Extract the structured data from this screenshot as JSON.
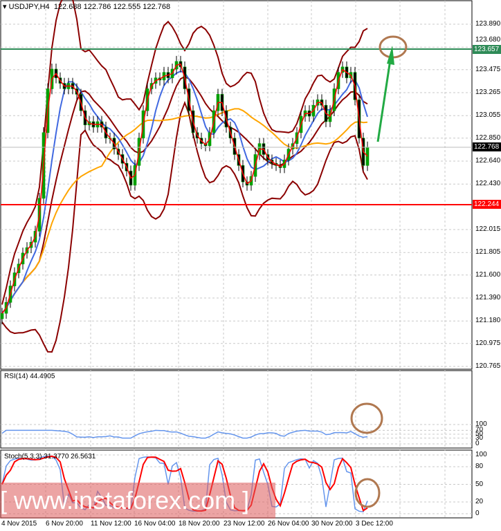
{
  "header": {
    "symbol": "USDJPY,H4",
    "open": "122.688",
    "high": "122.786",
    "low": "122.555",
    "close": "122.768"
  },
  "price_axis": [
    "123.890",
    "123.680",
    "123.475",
    "123.265",
    "123.055",
    "122.850",
    "122.640",
    "122.430",
    "122.015",
    "121.805",
    "121.600",
    "121.390",
    "121.180",
    "120.975",
    "120.765"
  ],
  "tags": {
    "resistance": "123.657",
    "current": "122.768",
    "support": "122.244"
  },
  "rsi": {
    "label": "RSI(14) 44.4905",
    "axis": [
      "100",
      "70",
      "50",
      "30",
      "0"
    ]
  },
  "stoch": {
    "label": "Stoch(5,3,3) 31.3770 26.5631",
    "axis": [
      "100",
      "80",
      "50",
      "20",
      "0"
    ]
  },
  "time_axis": [
    "4 Nov 2015",
    "6 Nov 20:00",
    "11 Nov 12:00",
    "16 Nov 04:00",
    "18 Nov 20:00",
    "23 Nov 12:00",
    "26 Nov 04:00",
    "30 Nov 20:00",
    "3 Dec 12:00"
  ],
  "watermark": "[ www.instaforex.com ]",
  "colors": {
    "resistance": "#2e8b57",
    "support": "#ff0000",
    "bull": "#00a000",
    "ma_fast": "#ff0000",
    "ma_mid": "#4169e1",
    "ma_slow": "#ffa500",
    "bands": "#8b0000",
    "annotation": "#b07850",
    "arrow": "#22aa44"
  },
  "chart_data": {
    "type": "candlestick",
    "ylim": [
      120.765,
      123.89
    ],
    "closes": [
      121.25,
      121.35,
      121.5,
      121.62,
      121.7,
      121.8,
      121.85,
      121.9,
      122.0,
      122.3,
      122.9,
      123.3,
      123.48,
      123.4,
      123.35,
      123.3,
      123.35,
      123.3,
      123.25,
      123.1,
      122.97,
      123.0,
      122.95,
      123.0,
      122.95,
      122.85,
      122.85,
      122.75,
      122.7,
      122.62,
      122.55,
      122.42,
      122.6,
      122.85,
      123.1,
      123.3,
      123.35,
      123.4,
      123.38,
      123.45,
      123.4,
      123.48,
      123.55,
      123.5,
      123.3,
      123.1,
      122.9,
      122.85,
      122.8,
      122.78,
      122.9,
      123.1,
      123.25,
      123.1,
      122.95,
      122.85,
      122.7,
      122.6,
      122.45,
      122.42,
      122.5,
      122.7,
      122.8,
      122.7,
      122.65,
      122.62,
      122.6,
      122.58,
      122.65,
      122.75,
      122.8,
      122.9,
      123.05,
      123.1,
      123.05,
      123.15,
      123.2,
      123.15,
      123.0,
      123.1,
      123.3,
      123.45,
      123.5,
      123.4,
      123.45,
      123.2,
      122.85,
      122.6,
      122.768
    ]
  }
}
